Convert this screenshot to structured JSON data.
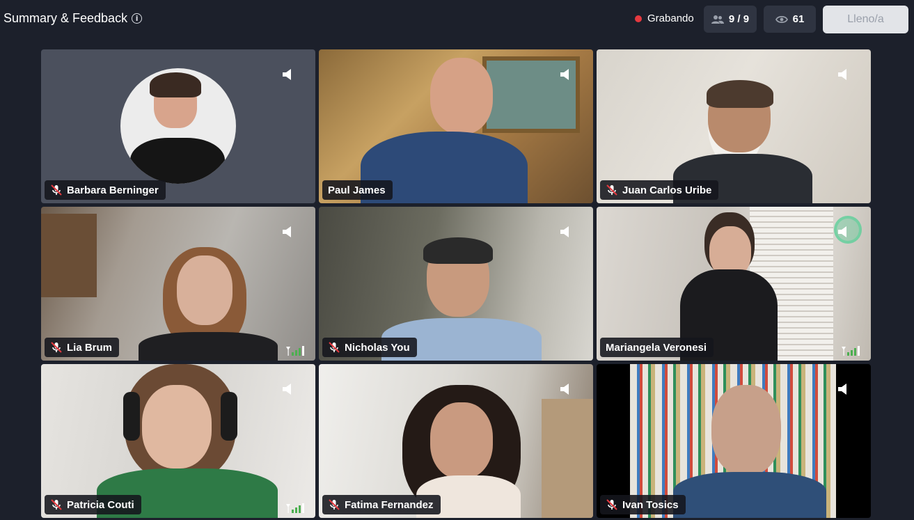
{
  "header": {
    "title": "Summary & Feedback",
    "info_icon": "info-icon",
    "recording_label": "Grabando",
    "recording_color": "#e5393f",
    "participants_count": "9 / 9",
    "viewers_count": "61",
    "full_button_label": "Lleno/a"
  },
  "participants": [
    {
      "name": "Barbara Berninger"
    },
    {
      "name": "Paul James"
    },
    {
      "name": "Juan Carlos Uribe"
    },
    {
      "name": "Lia Brum"
    },
    {
      "name": "Nicholas You"
    },
    {
      "name": "Mariangela Veronesi"
    },
    {
      "name": "Patricia Couti"
    },
    {
      "name": "Fatima Fernandez"
    },
    {
      "name": "Ivan Tosics"
    }
  ],
  "colors": {
    "background": "#1c202b",
    "pill": "#2f3441",
    "active_speaker_ring": "#50d296"
  }
}
